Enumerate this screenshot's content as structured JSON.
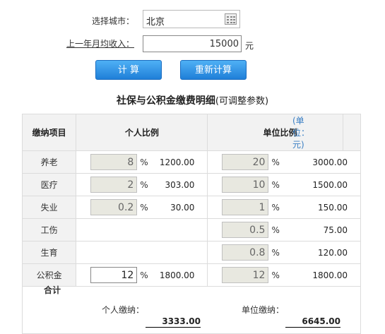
{
  "form": {
    "city_label": "选择城市：",
    "city_value": "北京",
    "income_label": "上一年月均收入：",
    "income_value": "15000",
    "income_unit": "元",
    "calc_button": "计 算",
    "recalc_button": "重新计算"
  },
  "table": {
    "title": "社保与公积金缴费明细",
    "title_sub": "(可调整参数)",
    "headers": {
      "item": "缴纳项目",
      "personal": "个人比例",
      "company": "单位比例",
      "unit": "(单位：元)"
    },
    "rows": [
      {
        "item": "养老",
        "p_ratio": "8",
        "p_pct": "%",
        "p_amount": "1200.00",
        "c_ratio": "20",
        "c_pct": "%",
        "c_amount": "3000.00"
      },
      {
        "item": "医疗",
        "p_ratio": "2",
        "p_pct": "%",
        "p_amount": "303.00",
        "c_ratio": "10",
        "c_pct": "%",
        "c_amount": "1500.00"
      },
      {
        "item": "失业",
        "p_ratio": "0.2",
        "p_pct": "%",
        "p_amount": "30.00",
        "c_ratio": "1",
        "c_pct": "%",
        "c_amount": "150.00"
      },
      {
        "item": "工伤",
        "c_ratio": "0.5",
        "c_pct": "%",
        "c_amount": "75.00"
      },
      {
        "item": "生育",
        "c_ratio": "0.8",
        "c_pct": "%",
        "c_amount": "120.00"
      },
      {
        "item": "公积金",
        "p_ratio": "12",
        "p_pct": "%",
        "p_amount": "1800.00",
        "c_ratio": "12",
        "c_pct": "%",
        "c_amount": "1800.00"
      }
    ],
    "total": {
      "label": "合计",
      "personal_label": "个人缴纳：",
      "personal_value": "3333.00",
      "company_label": "单位缴纳：",
      "company_value": "6645.00"
    }
  }
}
